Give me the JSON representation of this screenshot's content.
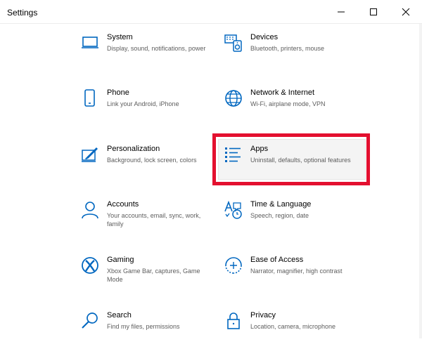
{
  "window": {
    "title": "Settings",
    "accent_color": "#0067c0",
    "highlight_color": "#e3102f"
  },
  "tiles": [
    {
      "title": "System",
      "desc": "Display, sound, notifications, power",
      "icon": "monitor-icon"
    },
    {
      "title": "Devices",
      "desc": "Bluetooth, printers, mouse",
      "icon": "devices-icon"
    },
    {
      "title": "Phone",
      "desc": "Link your Android, iPhone",
      "icon": "phone-icon"
    },
    {
      "title": "Network & Internet",
      "desc": "Wi-Fi, airplane mode, VPN",
      "icon": "globe-icon"
    },
    {
      "title": "Personalization",
      "desc": "Background, lock screen, colors",
      "icon": "paintbrush-icon"
    },
    {
      "title": "Apps",
      "desc": "Uninstall, defaults, optional features",
      "icon": "apps-list-icon"
    },
    {
      "title": "Accounts",
      "desc": "Your accounts, email, sync, work, family",
      "icon": "person-icon"
    },
    {
      "title": "Time & Language",
      "desc": "Speech, region, date",
      "icon": "time-language-icon"
    },
    {
      "title": "Gaming",
      "desc": "Xbox Game Bar, captures, Game Mode",
      "icon": "xbox-icon"
    },
    {
      "title": "Ease of Access",
      "desc": "Narrator, magnifier, high contrast",
      "icon": "ease-of-access-icon"
    },
    {
      "title": "Search",
      "desc": "Find my files, permissions",
      "icon": "search-icon"
    },
    {
      "title": "Privacy",
      "desc": "Location, camera, microphone",
      "icon": "lock-icon"
    }
  ]
}
